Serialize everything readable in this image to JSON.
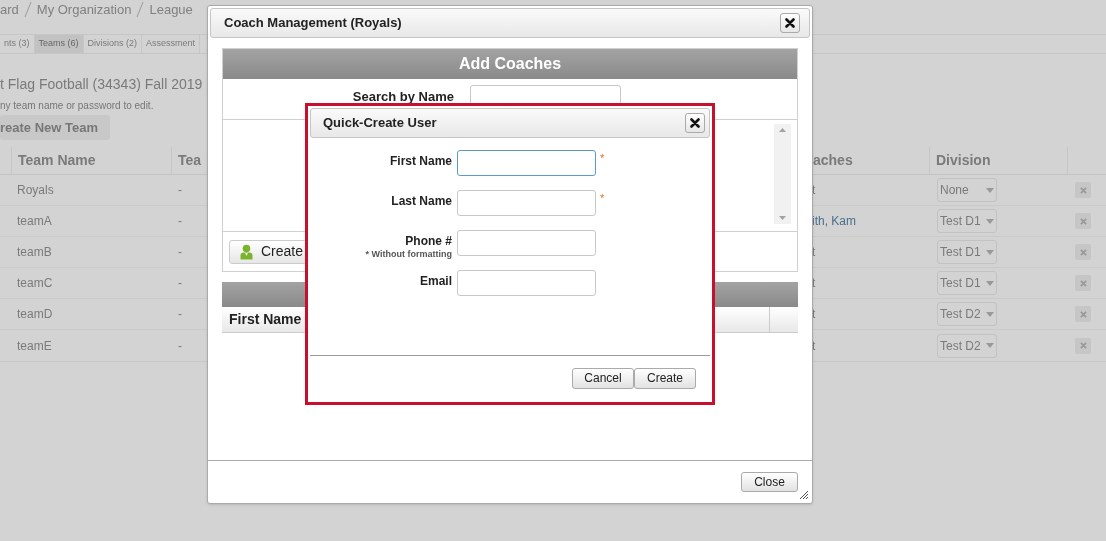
{
  "page": {
    "breadcrumb": [
      "ard",
      "My Organization",
      "League"
    ],
    "tabs": [
      {
        "label": "nts (3)",
        "selected": false
      },
      {
        "label": "Teams (6)",
        "selected": true
      },
      {
        "label": "Divisions (2)",
        "selected": false
      },
      {
        "label": "Assessment",
        "selected": false
      }
    ],
    "title": "t Flag Football (34343) Fall 2019",
    "hint": "ny team name or password to edit.",
    "create_button": "reate New Team",
    "table": {
      "columns": [
        "Team Name",
        "Tea",
        "aches",
        "Division"
      ],
      "rows": [
        {
          "team_name": "Royals",
          "column_3": "-",
          "coaches": "t",
          "linked": false,
          "division": "None"
        },
        {
          "team_name": "teamA",
          "column_3": "-",
          "coaches": "ith, Kam",
          "linked": true,
          "division": "Test D1"
        },
        {
          "team_name": "teamB",
          "column_3": "-",
          "coaches": "t",
          "linked": false,
          "division": "Test D1"
        },
        {
          "team_name": "teamC",
          "column_3": "-",
          "coaches": "t",
          "linked": false,
          "division": "Test D1"
        },
        {
          "team_name": "teamD",
          "column_3": "-",
          "coaches": "t",
          "linked": false,
          "division": "Test D2"
        },
        {
          "team_name": "teamE",
          "column_3": "-",
          "coaches": "t",
          "linked": false,
          "division": "Test D2"
        }
      ]
    }
  },
  "dialog": {
    "title": "Coach Management (Royals)",
    "section_title": "Add Coaches",
    "search_label": "Search by Name",
    "create_button": "Create",
    "coach_table": {
      "columns": [
        "First Name"
      ]
    },
    "close_button": "Close"
  },
  "quick_create": {
    "title": "Quick-Create User",
    "fields": [
      {
        "label": "First Name",
        "marker": "*",
        "focused": true
      },
      {
        "label": "Last Name",
        "marker": "*",
        "focused": false
      },
      {
        "label": "Phone #",
        "note": "* Without formatting",
        "focused": false
      },
      {
        "label": "Email",
        "focused": false
      }
    ],
    "buttons": [
      "Cancel",
      "Create"
    ]
  }
}
